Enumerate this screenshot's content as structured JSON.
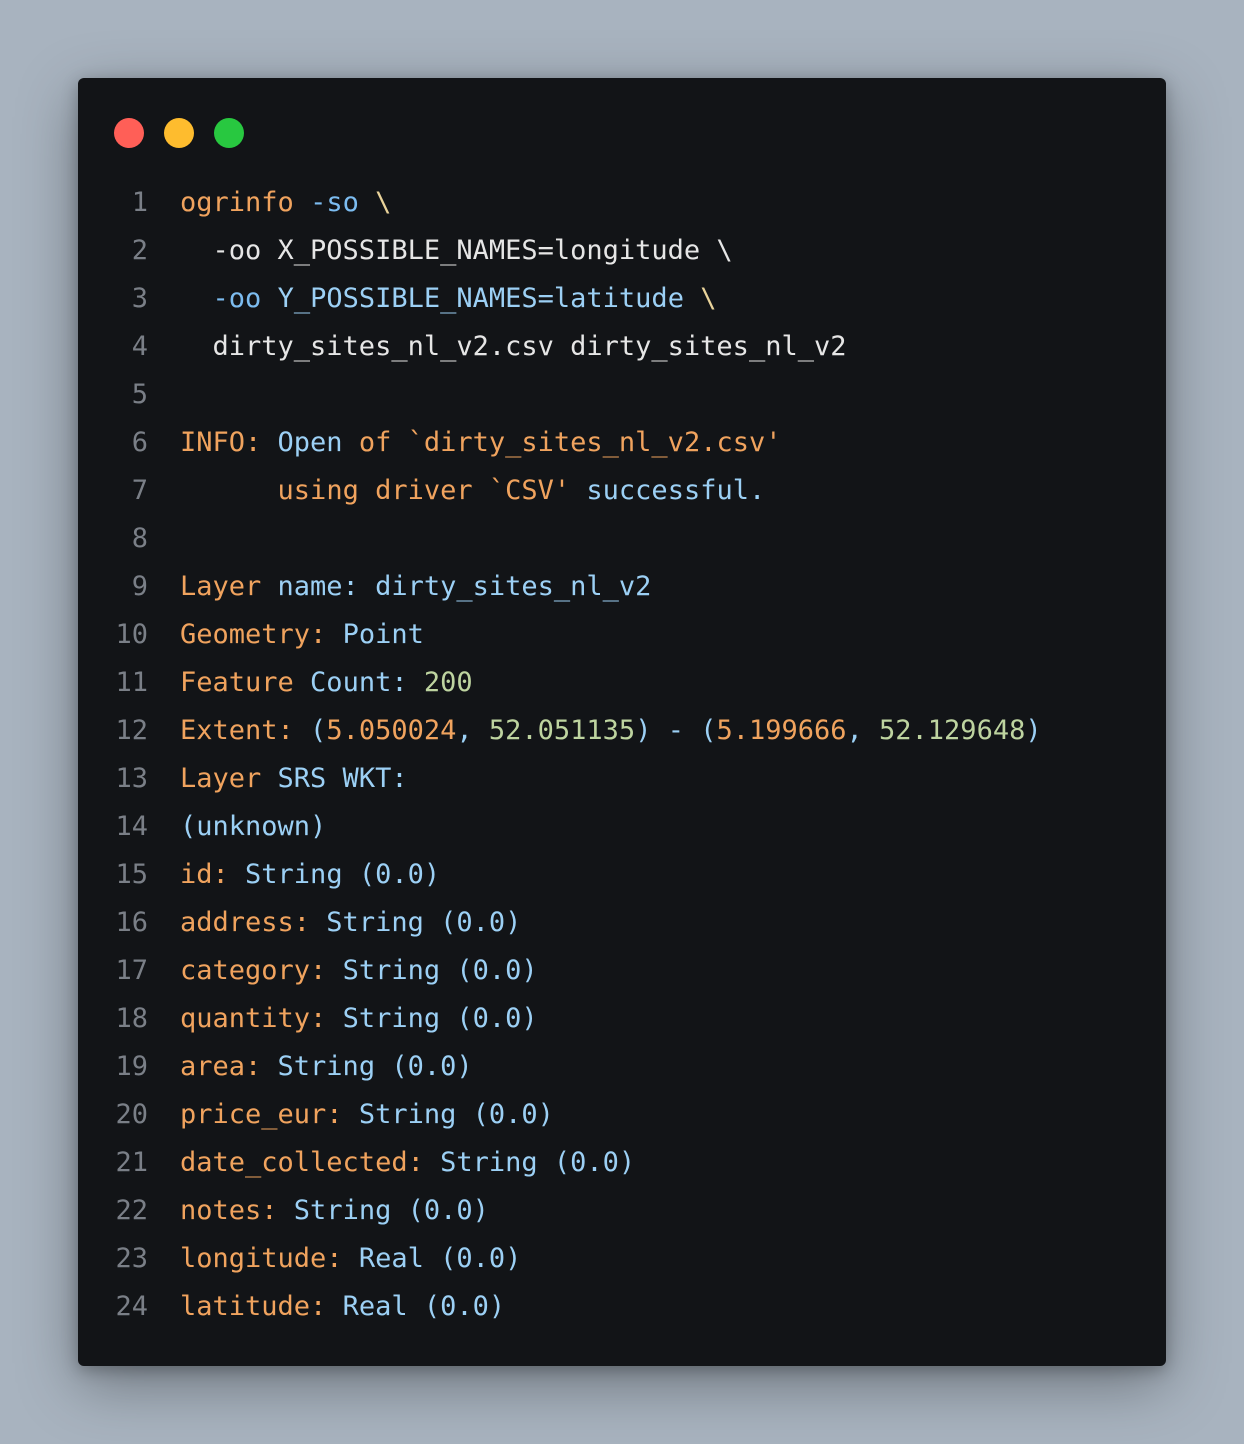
{
  "window": {
    "controls": [
      {
        "name": "close",
        "color": "#ff5f57"
      },
      {
        "name": "minimize",
        "color": "#febc2e"
      },
      {
        "name": "maximize",
        "color": "#28c840"
      }
    ]
  },
  "colors": {
    "background": "#a8b3bf",
    "window": "#121417",
    "line_number": "#7a7f87",
    "white": "#e6e6e6",
    "orange": "#f0a35e",
    "blue": "#9cd0f5",
    "green": "#bed4a0",
    "yellow": "#e9d39a"
  },
  "lines": [
    {
      "n": "1",
      "tokens": [
        {
          "t": "ogrinfo",
          "c": "orange"
        },
        {
          "t": " ",
          "c": "white"
        },
        {
          "t": "-so",
          "c": "lightblue"
        },
        {
          "t": " \\",
          "c": "yellow"
        }
      ]
    },
    {
      "n": "2",
      "tokens": [
        {
          "t": "  -oo X_POSSIBLE_NAMES=longitude \\",
          "c": "white"
        }
      ]
    },
    {
      "n": "3",
      "tokens": [
        {
          "t": "  ",
          "c": "white"
        },
        {
          "t": "-oo",
          "c": "lightblue"
        },
        {
          "t": " ",
          "c": "white"
        },
        {
          "t": "Y_POSSIBLE_NAMES=latitude",
          "c": "blue"
        },
        {
          "t": " \\",
          "c": "yellow"
        }
      ]
    },
    {
      "n": "4",
      "tokens": [
        {
          "t": "  dirty_sites_nl_v2.csv dirty_sites_nl_v2",
          "c": "white"
        }
      ]
    },
    {
      "n": "5",
      "tokens": []
    },
    {
      "n": "6",
      "tokens": [
        {
          "t": "INFO:",
          "c": "orange"
        },
        {
          "t": " Open ",
          "c": "blue"
        },
        {
          "t": "of",
          "c": "orange"
        },
        {
          "t": " `dirty_sites_nl_v2.csv'",
          "c": "orange"
        }
      ]
    },
    {
      "n": "7",
      "tokens": [
        {
          "t": "      ",
          "c": "white"
        },
        {
          "t": "using driver `CSV'",
          "c": "orange"
        },
        {
          "t": " successful.",
          "c": "blue"
        }
      ]
    },
    {
      "n": "8",
      "tokens": []
    },
    {
      "n": "9",
      "tokens": [
        {
          "t": "Layer",
          "c": "orange"
        },
        {
          "t": " name: dirty_sites_nl_v2",
          "c": "blue"
        }
      ]
    },
    {
      "n": "10",
      "tokens": [
        {
          "t": "Geometry:",
          "c": "orange"
        },
        {
          "t": " Point",
          "c": "blue"
        }
      ]
    },
    {
      "n": "11",
      "tokens": [
        {
          "t": "Feature",
          "c": "orange"
        },
        {
          "t": " Count: ",
          "c": "blue"
        },
        {
          "t": "200",
          "c": "green"
        }
      ]
    },
    {
      "n": "12",
      "tokens": [
        {
          "t": "Extent:",
          "c": "orange"
        },
        {
          "t": " (",
          "c": "blue"
        },
        {
          "t": "5.050024",
          "c": "orange"
        },
        {
          "t": ", ",
          "c": "blue"
        },
        {
          "t": "52.051135",
          "c": "green"
        },
        {
          "t": ") - (",
          "c": "blue"
        },
        {
          "t": "5.199666",
          "c": "orange"
        },
        {
          "t": ", ",
          "c": "blue"
        },
        {
          "t": "52.129648",
          "c": "green"
        },
        {
          "t": ")",
          "c": "blue"
        }
      ]
    },
    {
      "n": "13",
      "tokens": [
        {
          "t": "Layer",
          "c": "orange"
        },
        {
          "t": " SRS WKT:",
          "c": "blue"
        }
      ]
    },
    {
      "n": "14",
      "tokens": [
        {
          "t": "(unknown)",
          "c": "blue"
        }
      ]
    },
    {
      "n": "15",
      "tokens": [
        {
          "t": "id:",
          "c": "orange"
        },
        {
          "t": " String (0.0)",
          "c": "blue"
        }
      ]
    },
    {
      "n": "16",
      "tokens": [
        {
          "t": "address:",
          "c": "orange"
        },
        {
          "t": " String (0.0)",
          "c": "blue"
        }
      ]
    },
    {
      "n": "17",
      "tokens": [
        {
          "t": "category:",
          "c": "orange"
        },
        {
          "t": " String (0.0)",
          "c": "blue"
        }
      ]
    },
    {
      "n": "18",
      "tokens": [
        {
          "t": "quantity:",
          "c": "orange"
        },
        {
          "t": " String (0.0)",
          "c": "blue"
        }
      ]
    },
    {
      "n": "19",
      "tokens": [
        {
          "t": "area:",
          "c": "orange"
        },
        {
          "t": " String (0.0)",
          "c": "blue"
        }
      ]
    },
    {
      "n": "20",
      "tokens": [
        {
          "t": "price_eur:",
          "c": "orange"
        },
        {
          "t": " String (0.0)",
          "c": "blue"
        }
      ]
    },
    {
      "n": "21",
      "tokens": [
        {
          "t": "date_collected:",
          "c": "orange"
        },
        {
          "t": " String (0.0)",
          "c": "blue"
        }
      ]
    },
    {
      "n": "22",
      "tokens": [
        {
          "t": "notes:",
          "c": "orange"
        },
        {
          "t": " String (0.0)",
          "c": "blue"
        }
      ]
    },
    {
      "n": "23",
      "tokens": [
        {
          "t": "longitude:",
          "c": "orange"
        },
        {
          "t": " Real (0.0)",
          "c": "blue"
        }
      ]
    },
    {
      "n": "24",
      "tokens": [
        {
          "t": "latitude:",
          "c": "orange"
        },
        {
          "t": " Real (0.0)",
          "c": "blue"
        }
      ]
    }
  ]
}
